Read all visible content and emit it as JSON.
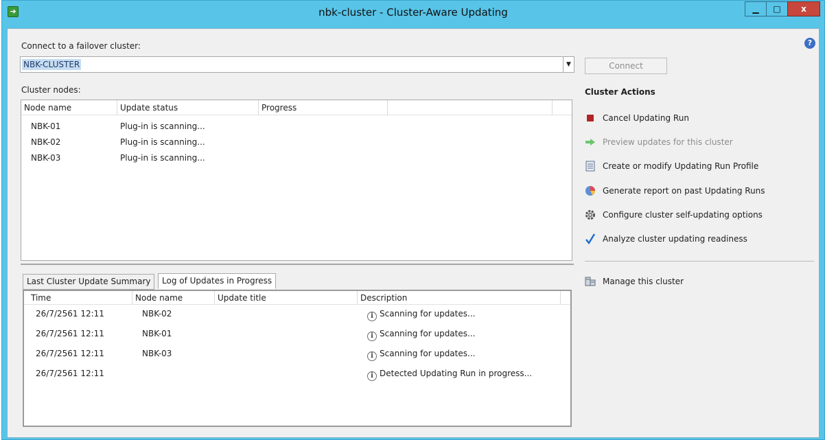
{
  "window": {
    "title": "nbk-cluster - Cluster-Aware Updating",
    "minimize_glyph": "▁",
    "maximize_glyph": "□",
    "close_glyph": "x"
  },
  "connect": {
    "label": "Connect to a failover cluster:",
    "value": "NBK-CLUSTER",
    "button_label": "Connect"
  },
  "nodes": {
    "label": "Cluster nodes:",
    "columns": [
      "Node name",
      "Update status",
      "Progress",
      ""
    ],
    "rows": [
      {
        "node": "NBK-01",
        "status": "Plug-in is scanning...",
        "progress": ""
      },
      {
        "node": "NBK-02",
        "status": "Plug-in is scanning...",
        "progress": ""
      },
      {
        "node": "NBK-03",
        "status": "Plug-in is scanning...",
        "progress": ""
      }
    ]
  },
  "tabs": [
    {
      "label": "Last Cluster Update Summary",
      "active": false
    },
    {
      "label": "Log of Updates in Progress",
      "active": true
    }
  ],
  "log": {
    "columns": [
      "Time",
      "Node name",
      "Update title",
      "Description"
    ],
    "rows": [
      {
        "time": "26/7/2561 12:11",
        "node": "NBK-02",
        "title": "",
        "description": "Scanning for updates..."
      },
      {
        "time": "26/7/2561 12:11",
        "node": "NBK-01",
        "title": "",
        "description": "Scanning for updates..."
      },
      {
        "time": "26/7/2561 12:11",
        "node": "NBK-03",
        "title": "",
        "description": "Scanning for updates..."
      },
      {
        "time": "26/7/2561 12:11",
        "node": "",
        "title": "",
        "description": "Detected Updating Run in progress..."
      }
    ]
  },
  "actions": {
    "title": "Cluster Actions",
    "items": [
      {
        "label": "Cancel Updating Run",
        "icon": "stop-icon",
        "enabled": true
      },
      {
        "label": "Preview updates for this cluster",
        "icon": "arrow-right-icon",
        "enabled": false
      },
      {
        "label": "Create or modify Updating Run Profile",
        "icon": "document-icon",
        "enabled": true
      },
      {
        "label": "Generate report on past Updating Runs",
        "icon": "report-icon",
        "enabled": true
      },
      {
        "label": "Configure cluster self-updating options",
        "icon": "gear-icon",
        "enabled": true
      },
      {
        "label": "Analyze cluster updating readiness",
        "icon": "checkmark-icon",
        "enabled": true
      }
    ],
    "manage": {
      "label": "Manage this cluster",
      "icon": "server-icon"
    }
  },
  "colors": {
    "titlebar": "#58c4e8",
    "close": "#c7473c",
    "selection": "#c6dcf0",
    "stop": "#b32424",
    "preview_arrow": "#6fc46f",
    "check": "#1f6fd1"
  }
}
